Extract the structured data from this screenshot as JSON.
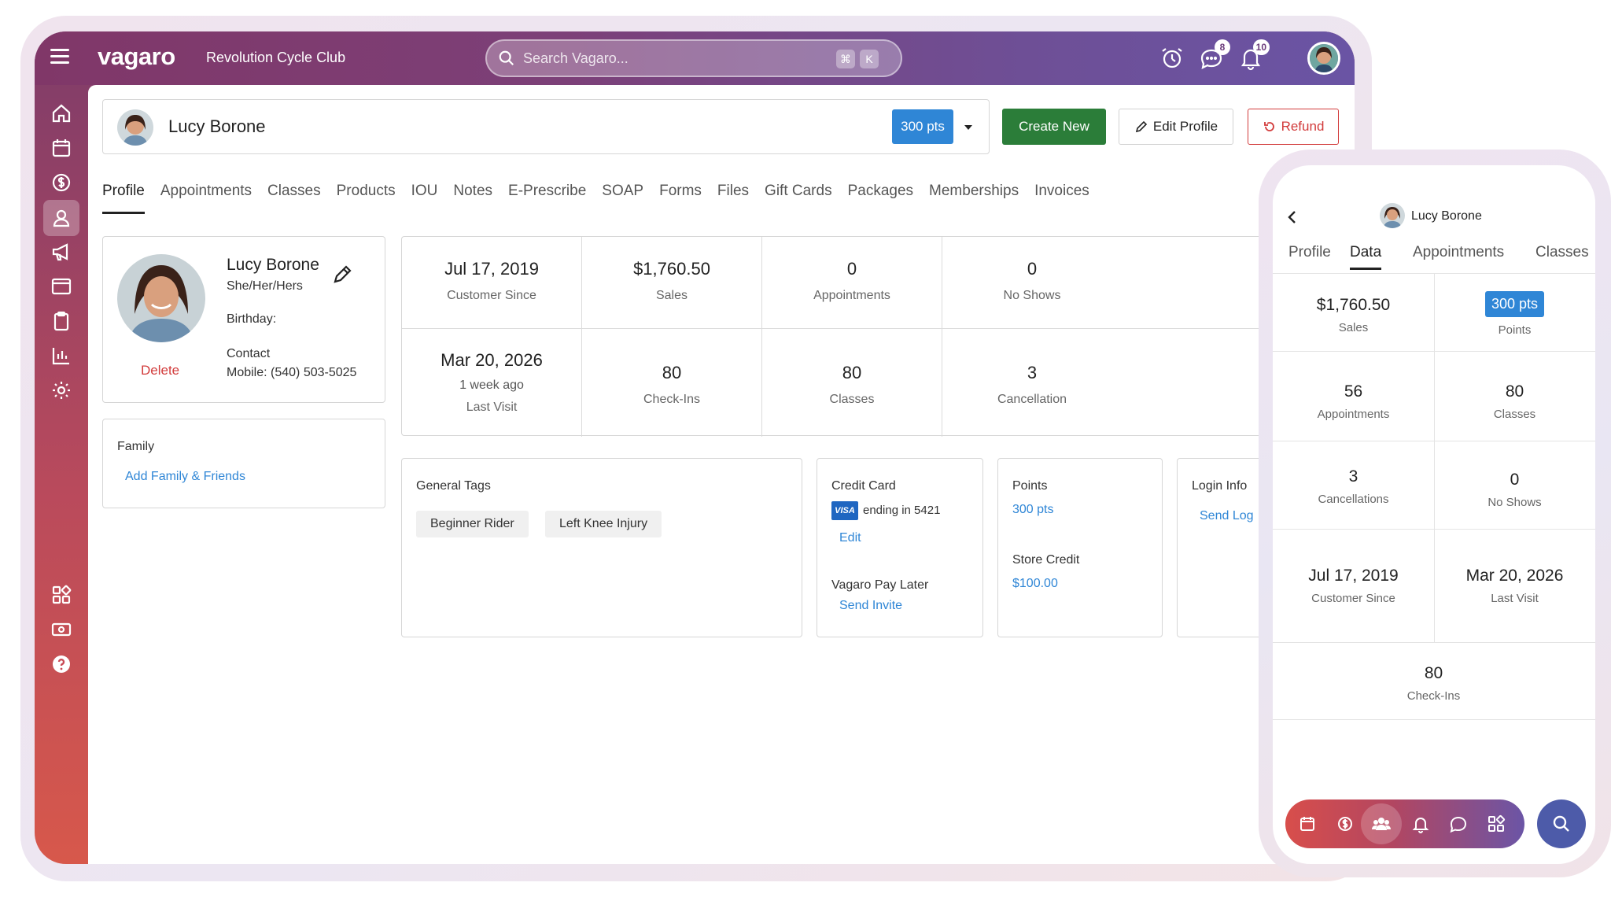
{
  "app": {
    "logo": "vagaro",
    "business": "Revolution Cycle Club",
    "search_placeholder": "Search Vagaro...",
    "shortcut_keys": [
      "⌘",
      "K"
    ],
    "messages_badge": "8",
    "notifications_badge": "10",
    "colors": {
      "topbar_start": "#803768",
      "topbar_end": "#6a54a4",
      "primary_blue": "#2f86d6",
      "create_green": "#2b7d39",
      "refund_red": "#d23b3b"
    }
  },
  "sidebar": {
    "icons": [
      "home-icon",
      "calendar-icon",
      "dollar-icon",
      "customer-icon",
      "megaphone-icon",
      "browser-icon",
      "clipboard-icon",
      "chart-icon",
      "gear-icon",
      "apps-icon",
      "cash-icon",
      "help-icon"
    ],
    "active": "customer-icon"
  },
  "customer_bar": {
    "name": "Lucy Borone",
    "points": "300 pts",
    "create_new": "Create New",
    "edit_profile": "Edit Profile",
    "refund": "Refund"
  },
  "tabs": [
    "Profile",
    "Appointments",
    "Classes",
    "Products",
    "IOU",
    "Notes",
    "E-Prescribe",
    "SOAP",
    "Forms",
    "Files",
    "Gift Cards",
    "Packages",
    "Memberships",
    "Invoices"
  ],
  "active_tab": "Profile",
  "profile": {
    "name": "Lucy Borone",
    "pronouns": "She/Her/Hers",
    "birthday_label": "Birthday:",
    "contact_label": "Contact",
    "mobile": "Mobile: (540) 503-5025",
    "delete": "Delete"
  },
  "family": {
    "title": "Family",
    "add_link": "Add Family & Friends"
  },
  "stats": {
    "customer_since": {
      "value": "Jul 17, 2019",
      "label": "Customer Since"
    },
    "sales": {
      "value": "$1,760.50",
      "label": "Sales"
    },
    "appointments": {
      "value": "0",
      "label": "Appointments"
    },
    "no_shows": {
      "value": "0",
      "label": "No Shows"
    },
    "last_visit": {
      "value": "Mar 20, 2026",
      "sub": "1 week ago",
      "label": "Last Visit"
    },
    "check_ins": {
      "value": "80",
      "label": "Check-Ins"
    },
    "classes": {
      "value": "80",
      "label": "Classes"
    },
    "cancellations": {
      "value": "3",
      "label": "Cancellation"
    }
  },
  "tags": {
    "title": "General Tags",
    "items": [
      "Beginner Rider",
      "Left Knee Injury"
    ]
  },
  "credit_card": {
    "title": "Credit Card",
    "brand": "VISA",
    "ending": "ending in 5421",
    "edit": "Edit",
    "pay_later_title": "Vagaro Pay Later",
    "send_invite": "Send Invite"
  },
  "points_card": {
    "title": "Points",
    "points": "300 pts",
    "store_credit_title": "Store Credit",
    "store_credit": "$100.00"
  },
  "login_card": {
    "title": "Login Info",
    "send_link": "Send Log"
  },
  "phone": {
    "name": "Lucy Borone",
    "tabs": [
      "Profile",
      "Data",
      "Appointments",
      "Classes"
    ],
    "active_tab": "Data",
    "sales": {
      "value": "$1,760.50",
      "label": "Sales"
    },
    "points": {
      "value": "300 pts",
      "label": "Points"
    },
    "appointments": {
      "value": "56",
      "label": "Appointments"
    },
    "classes": {
      "value": "80",
      "label": "Classes"
    },
    "cancellations": {
      "value": "3",
      "label": "Cancellations"
    },
    "no_shows": {
      "value": "0",
      "label": "No Shows"
    },
    "customer_since": {
      "value": "Jul 17, 2019",
      "label": "Customer Since"
    },
    "last_visit": {
      "value": "Mar 20, 2026",
      "label": "Last Visit"
    },
    "check_ins": {
      "value": "80",
      "label": "Check-Ins"
    },
    "bottom_nav": [
      "calendar-icon",
      "dollar-icon",
      "customers-icon",
      "bell-icon",
      "chat-icon",
      "apps-icon"
    ],
    "bottom_nav_active": "customers-icon"
  }
}
